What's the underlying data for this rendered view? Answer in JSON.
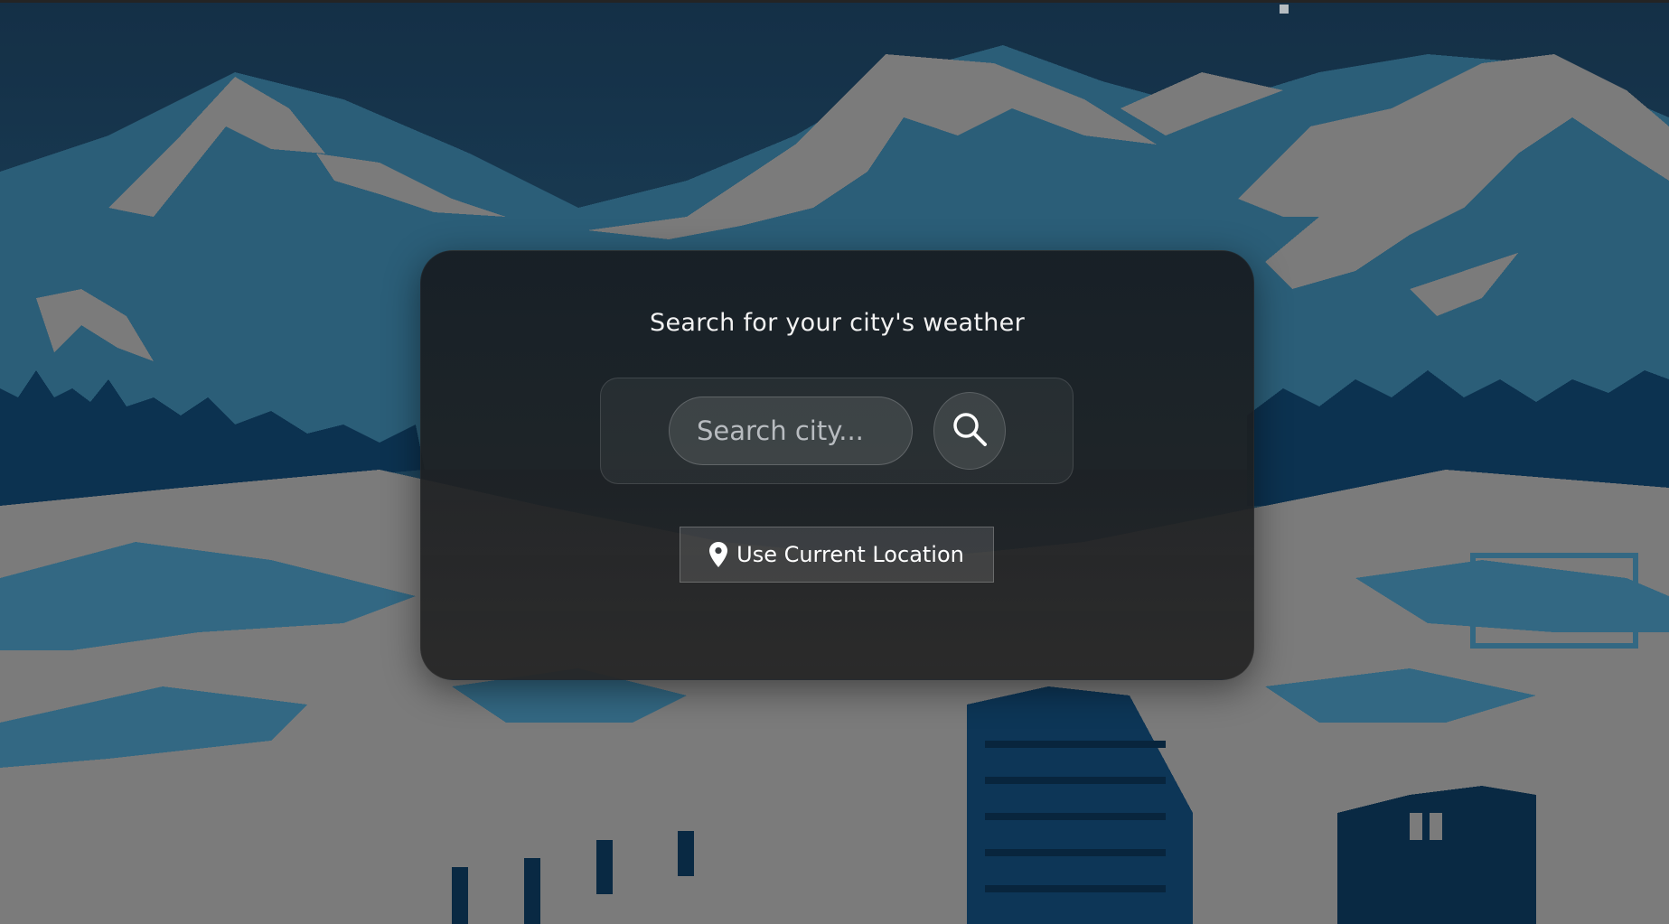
{
  "card": {
    "title": "Search for your city's weather"
  },
  "search": {
    "placeholder": "Search city...",
    "icon": "search-icon"
  },
  "location": {
    "label": "Use Current Location",
    "icon": "map-pin-icon"
  },
  "colors": {
    "sky": "#1b3a52",
    "snow": "#8f8f8f",
    "mountain_blue": "#2f6682",
    "trees": "#0d3554",
    "card_bg": "#1e2226"
  }
}
